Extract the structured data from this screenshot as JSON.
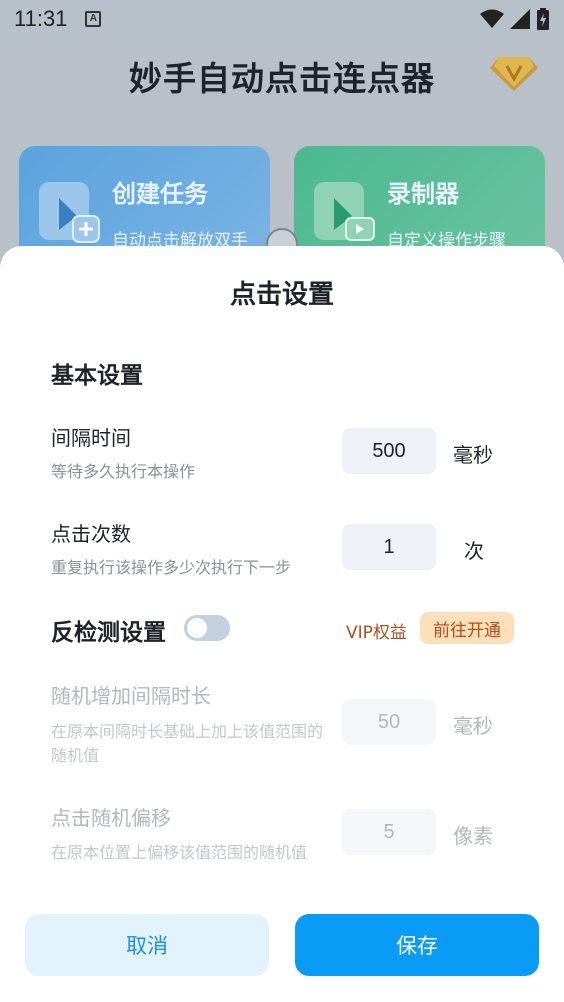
{
  "status_bar": {
    "time": "11:31",
    "notification_letter": "A"
  },
  "app": {
    "title": "妙手自动点击连点器",
    "cards": [
      {
        "title": "创建任务",
        "subtitle": "自动点击解放双手"
      },
      {
        "title": "录制器",
        "subtitle": "自定义操作步骤"
      }
    ]
  },
  "sheet": {
    "title": "点击设置",
    "basic_section": "基本设置",
    "interval": {
      "label": "间隔时间",
      "desc": "等待多久执行本操作",
      "value": "500",
      "unit": "毫秒"
    },
    "click_count": {
      "label": "点击次数",
      "desc": "重复执行该操作多少次执行下一步",
      "value": "1",
      "unit": "次"
    },
    "anti_detect": {
      "label": "反检测设置",
      "enabled": false,
      "vip_text": "VIP权益",
      "vip_button": "前往开通"
    },
    "random_interval": {
      "label": "随机增加间隔时长",
      "desc": "在原本间隔时长基础上加上该值范围的随机值",
      "value": "50",
      "unit": "毫秒"
    },
    "random_offset": {
      "label": "点击随机偏移",
      "desc": "在原本位置上偏移该值范围的随机值",
      "value": "5",
      "unit": "像素"
    },
    "cancel_label": "取消",
    "save_label": "保存"
  },
  "colors": {
    "primary": "#0a9bf7",
    "vip": "#b24d1d",
    "vip_bg": "#fde0b9"
  }
}
